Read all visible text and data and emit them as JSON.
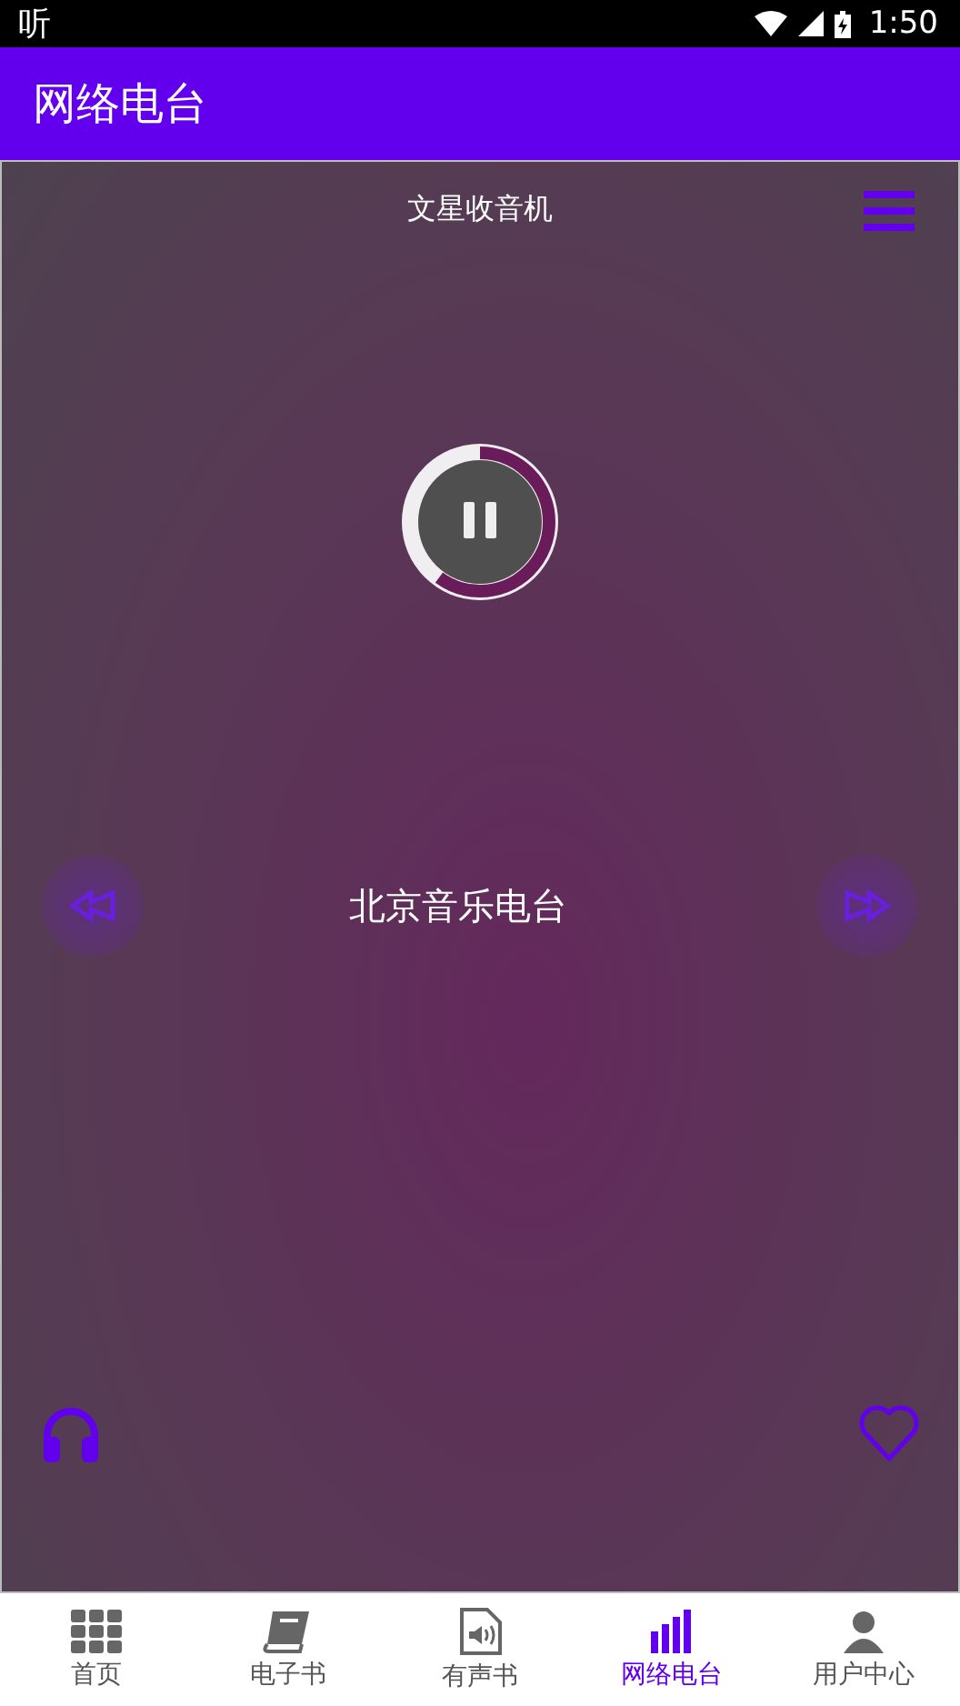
{
  "status_bar": {
    "app_mark": "听",
    "time": "1:50"
  },
  "app_bar": {
    "title": "网络电台"
  },
  "player": {
    "title": "文星收音机",
    "station": "北京音乐电台",
    "playing": true
  },
  "bottom_nav": [
    {
      "label": "首页",
      "selected": false
    },
    {
      "label": "电子书",
      "selected": false
    },
    {
      "label": "有声书",
      "selected": false
    },
    {
      "label": "网络电台",
      "selected": true
    },
    {
      "label": "用户中心",
      "selected": false
    }
  ]
}
